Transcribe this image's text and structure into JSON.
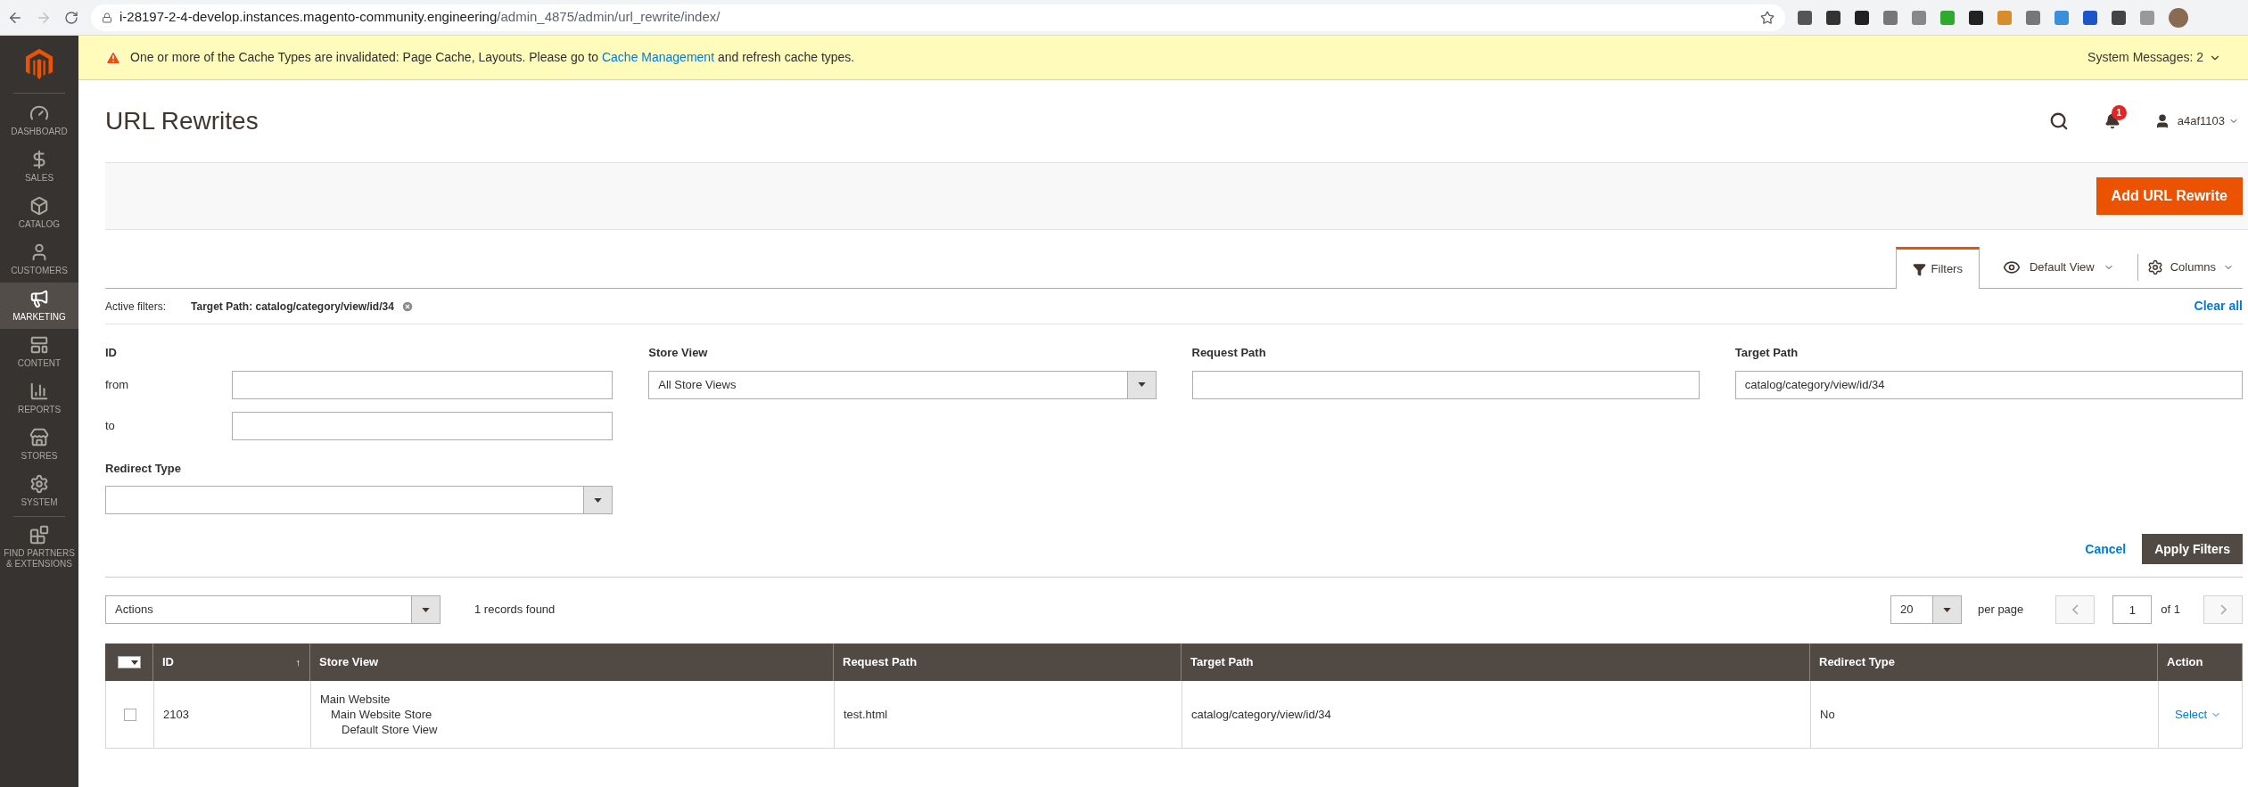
{
  "browser": {
    "url_host": "i-28197-2-4-develop.instances.magento-community.engineering",
    "url_path": "/admin_4875/admin/url_rewrite/index/"
  },
  "sidebar": {
    "items": [
      {
        "kind": "dashboard",
        "label": "DASHBOARD",
        "selected": false
      },
      {
        "kind": "sales",
        "label": "SALES",
        "selected": false
      },
      {
        "kind": "catalog",
        "label": "CATALOG",
        "selected": false
      },
      {
        "kind": "customers",
        "label": "CUSTOMERS",
        "selected": false
      },
      {
        "kind": "marketing",
        "label": "MARKETING",
        "selected": true
      },
      {
        "kind": "content",
        "label": "CONTENT",
        "selected": false
      },
      {
        "kind": "reports",
        "label": "REPORTS",
        "selected": false
      },
      {
        "kind": "stores",
        "label": "STORES",
        "selected": false
      },
      {
        "kind": "system",
        "label": "SYSTEM",
        "selected": false
      },
      {
        "kind": "partners",
        "label": "FIND PARTNERS & EXTENSIONS",
        "selected": false
      }
    ]
  },
  "message": {
    "before": "One or more of the Cache Types are invalidated: Page Cache, Layouts. Please go to ",
    "link": "Cache Management",
    "after": " and refresh cache types.",
    "system_messages": "System Messages: 2"
  },
  "header": {
    "title": "URL Rewrites",
    "notifications": "1",
    "user": "a4af1103"
  },
  "actions": {
    "primary": "Add URL Rewrite"
  },
  "toolbar": {
    "tabs": [
      {
        "label": "Filters",
        "selected": true
      }
    ],
    "view": "Default View",
    "columns": "Columns"
  },
  "active_filters": {
    "label": "Active filters:",
    "chips": [
      "Target Path: catalog/category/view/id/34"
    ],
    "clear": "Clear all"
  },
  "filters": {
    "id": {
      "label": "ID",
      "from_label": "from",
      "to_label": "to"
    },
    "store_view": {
      "label": "Store View",
      "value": "All Store Views"
    },
    "request_path": {
      "label": "Request Path"
    },
    "target_path": {
      "label": "Target Path",
      "value": "catalog/category/view/id/34"
    },
    "redirect_type": {
      "label": "Redirect Type"
    },
    "cancel": "Cancel",
    "apply": "Apply Filters"
  },
  "grid": {
    "actions": "Actions",
    "records": "1 records found",
    "page_size": "20",
    "per_page": "per page",
    "page": "1",
    "of": "of 1"
  },
  "table": {
    "mass_select": {
      "checked": false
    },
    "columns": [
      {
        "label": "ID",
        "sort": "↑"
      },
      {
        "label": "Store View"
      },
      {
        "label": "Request Path"
      },
      {
        "label": "Target Path"
      },
      {
        "label": "Redirect Type"
      },
      {
        "label": "Action"
      }
    ],
    "rows": [
      {
        "checked": false,
        "id": "2103",
        "store_view": [
          "Main Website",
          "Main Website Store",
          "Default Store View"
        ],
        "request_path": "test.html",
        "target_path": "catalog/category/view/id/34",
        "redirect_type": "No",
        "action": "Select"
      }
    ]
  }
}
